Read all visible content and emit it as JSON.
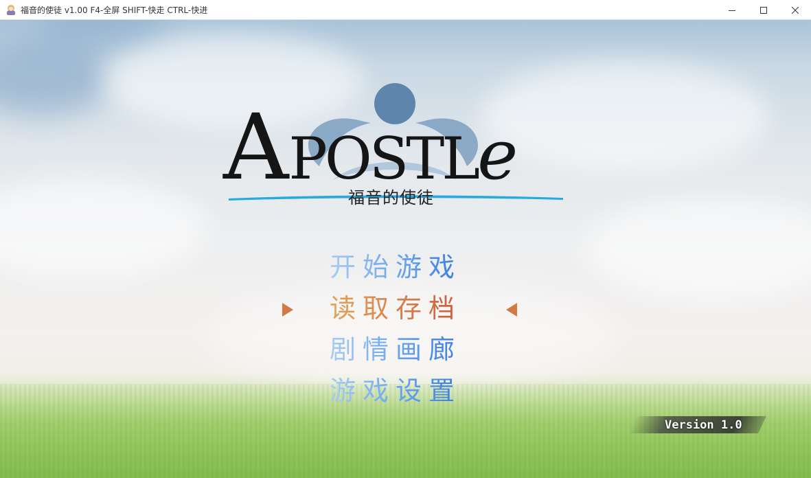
{
  "window": {
    "title": "福音的使徒 v1.00 F4-全屏 SHIFT-快走 CTRL-快进",
    "app_icon": "character-icon",
    "controls": [
      "minimize-icon",
      "maximize-icon",
      "close-icon"
    ]
  },
  "logo": {
    "title": "APOSTLe",
    "title_parts": [
      "A",
      "POSTL",
      "e"
    ],
    "subtitle": "福音的使徒",
    "emblem": "figure-emblem-icon"
  },
  "menu": {
    "items": [
      {
        "label": "开始游戏",
        "selected": false
      },
      {
        "label": "读取存档",
        "selected": true
      },
      {
        "label": "剧情画廊",
        "selected": false
      },
      {
        "label": "游戏设置",
        "selected": false
      }
    ],
    "cursor_icon": "triangle-pointer-icon"
  },
  "version": {
    "label": "Version 1.0"
  },
  "colors": {
    "menu_blue": "#2b6fe0",
    "menu_blue_light": "#a8cdf3",
    "menu_selected": "#d47d4a",
    "cursor": "#d27a44",
    "logo_text": "#151515",
    "logo_emblem": "#5e86ad",
    "logo_underline": "#28a9e0"
  }
}
